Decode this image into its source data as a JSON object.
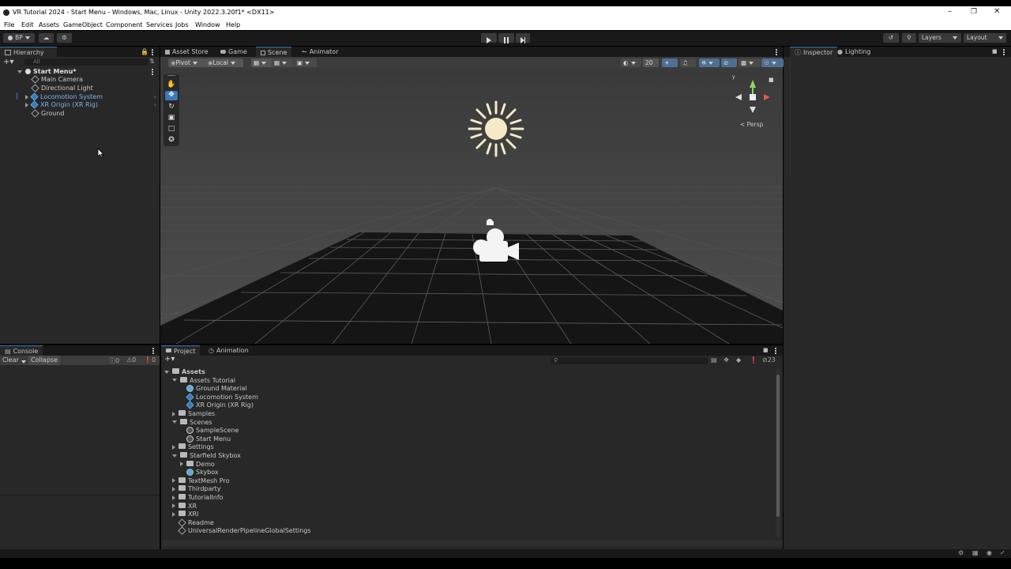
{
  "window": {
    "title": "VR Tutorial 2024 - Start Menu - Windows, Mac, Linux - Unity 2022.3.20f1* <DX11>"
  },
  "menu": [
    "File",
    "Edit",
    "Assets",
    "GameObject",
    "Component",
    "Services",
    "Jobs",
    "Window",
    "Help"
  ],
  "toolbar": {
    "account": "BP",
    "layers": "Layers",
    "layout": "Layout"
  },
  "hierarchy": {
    "tab": "Hierarchy",
    "search_placeholder": "All",
    "scene": "Start Menu*",
    "items": [
      {
        "label": "Main Camera",
        "prefab": false,
        "expandable": false
      },
      {
        "label": "Directional Light",
        "prefab": false,
        "expandable": false
      },
      {
        "label": "Locomotion System",
        "prefab": true,
        "expandable": true
      },
      {
        "label": "XR Origin (XR Rig)",
        "prefab": true,
        "expandable": true
      },
      {
        "label": "Ground",
        "prefab": false,
        "expandable": false
      }
    ]
  },
  "center_tabs": [
    "Asset Store",
    "Game",
    "Scene",
    "Animator"
  ],
  "active_center_tab": "Scene",
  "scene_toolbar": {
    "pivot": "Pivot",
    "local": "Local",
    "grid_size": "20",
    "persp": "< Persp"
  },
  "right_tabs": [
    "Inspector",
    "Lighting"
  ],
  "console": {
    "tab": "Console",
    "clear": "Clear",
    "collapse": "Collapse",
    "counts": [
      "0",
      "0",
      "0"
    ]
  },
  "project": {
    "tabs": [
      "Project",
      "Animation"
    ],
    "hidden_count": "23",
    "tree": [
      {
        "label": "Assets",
        "depth": 0,
        "type": "folder",
        "state": "open",
        "bold": true
      },
      {
        "label": "Assets Tutorial",
        "depth": 1,
        "type": "folder",
        "state": "open"
      },
      {
        "label": "Ground Material",
        "depth": 2,
        "type": "material"
      },
      {
        "label": "Locomotion System",
        "depth": 2,
        "type": "prefab"
      },
      {
        "label": "XR Origin (XR Rig)",
        "depth": 2,
        "type": "prefab"
      },
      {
        "label": "Samples",
        "depth": 1,
        "type": "folder",
        "state": "closed"
      },
      {
        "label": "Scenes",
        "depth": 1,
        "type": "folder",
        "state": "open"
      },
      {
        "label": "SampleScene",
        "depth": 2,
        "type": "scene"
      },
      {
        "label": "Start Menu",
        "depth": 2,
        "type": "scene"
      },
      {
        "label": "Settings",
        "depth": 1,
        "type": "folder",
        "state": "closed"
      },
      {
        "label": "Starfield Skybox",
        "depth": 1,
        "type": "folder",
        "state": "open"
      },
      {
        "label": "Demo",
        "depth": 2,
        "type": "folder",
        "state": "closed"
      },
      {
        "label": "Skybox",
        "depth": 2,
        "type": "material"
      },
      {
        "label": "TextMesh Pro",
        "depth": 1,
        "type": "folder",
        "state": "closed"
      },
      {
        "label": "Thirdparty",
        "depth": 1,
        "type": "folder",
        "state": "closed"
      },
      {
        "label": "TutorialInfo",
        "depth": 1,
        "type": "folder",
        "state": "closed"
      },
      {
        "label": "XR",
        "depth": 1,
        "type": "folder",
        "state": "closed"
      },
      {
        "label": "XRI",
        "depth": 1,
        "type": "folder",
        "state": "closed"
      },
      {
        "label": "Readme",
        "depth": 1,
        "type": "asset"
      },
      {
        "label": "UniversalRenderPipelineGlobalSettings",
        "depth": 1,
        "type": "asset"
      }
    ]
  }
}
